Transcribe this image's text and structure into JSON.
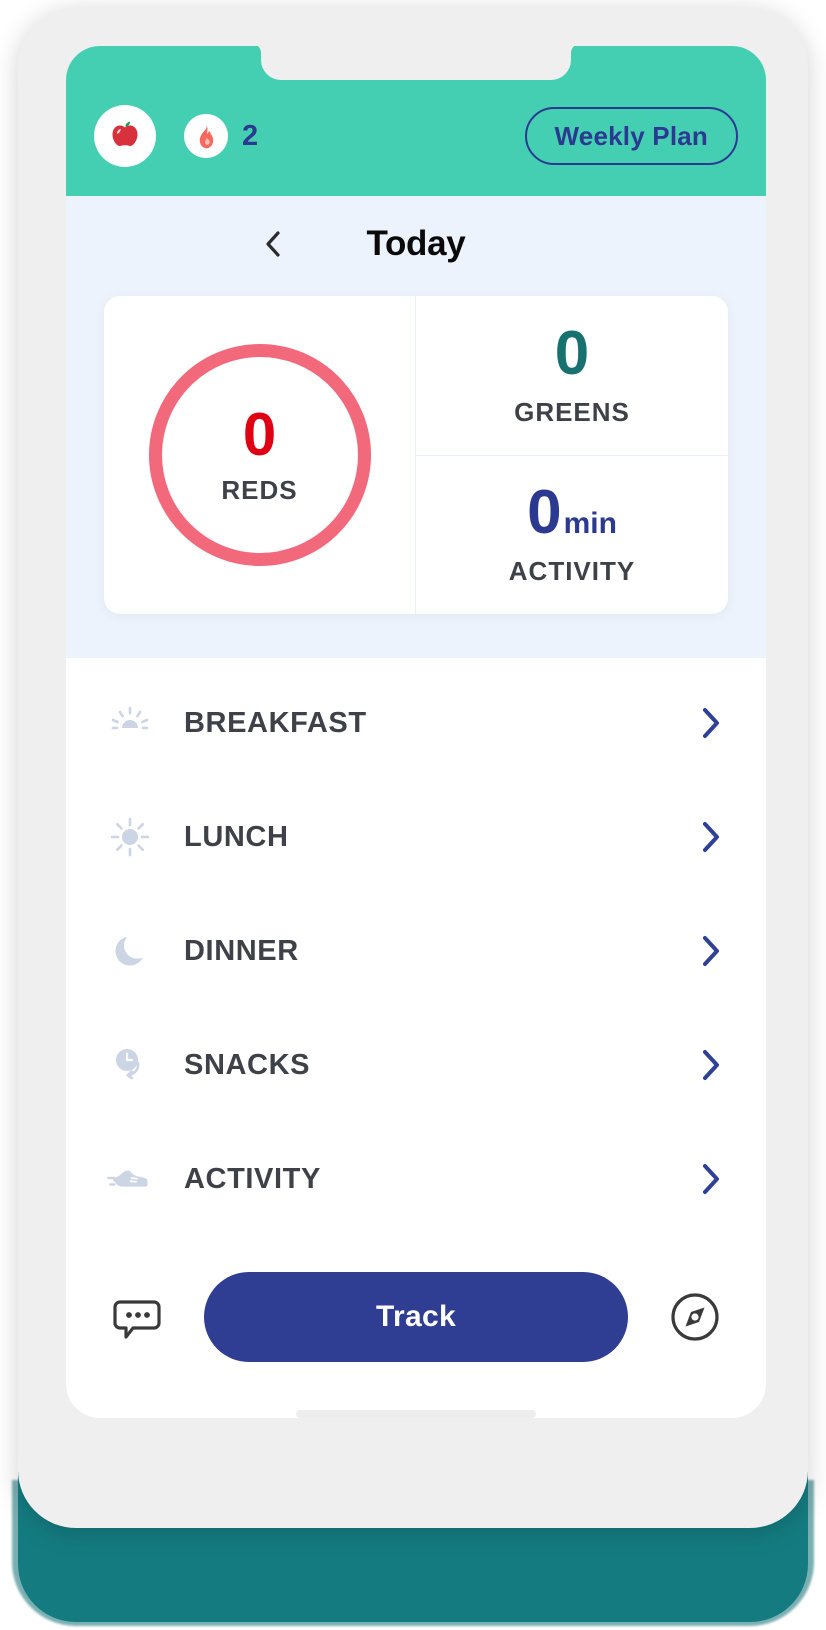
{
  "app": {
    "header": {
      "logo_icon": "apple-icon",
      "streak_icon": "flame-icon",
      "streak_count": "2",
      "weekly_plan_label": "Weekly Plan",
      "background_color": "#45CFB2"
    },
    "nav": {
      "back_icon": "chevron-left-icon",
      "title": "Today"
    },
    "summary": {
      "reds": {
        "value": "0",
        "label": "REDS",
        "ring_color": "#F2697C",
        "value_color": "#E00014"
      },
      "greens": {
        "value": "0",
        "label": "GREENS",
        "value_color": "#17716F"
      },
      "activity": {
        "value": "0",
        "unit": "min",
        "label": "ACTIVITY",
        "value_color": "#2B3990"
      }
    },
    "meals": [
      {
        "icon": "sunrise-icon",
        "label": "BREAKFAST",
        "chevron": "chevron-right-icon"
      },
      {
        "icon": "sun-icon",
        "label": "LUNCH",
        "chevron": "chevron-right-icon"
      },
      {
        "icon": "moon-icon",
        "label": "DINNER",
        "chevron": "chevron-right-icon"
      },
      {
        "icon": "clock-arrow-icon",
        "label": "SNACKS",
        "chevron": "chevron-right-icon"
      },
      {
        "icon": "running-shoe-icon",
        "label": "ACTIVITY",
        "chevron": "chevron-right-icon"
      }
    ],
    "bottom": {
      "chat_icon": "chat-bubble-icon",
      "track_label": "Track",
      "explore_icon": "compass-icon",
      "track_color": "#2F3D92"
    }
  }
}
